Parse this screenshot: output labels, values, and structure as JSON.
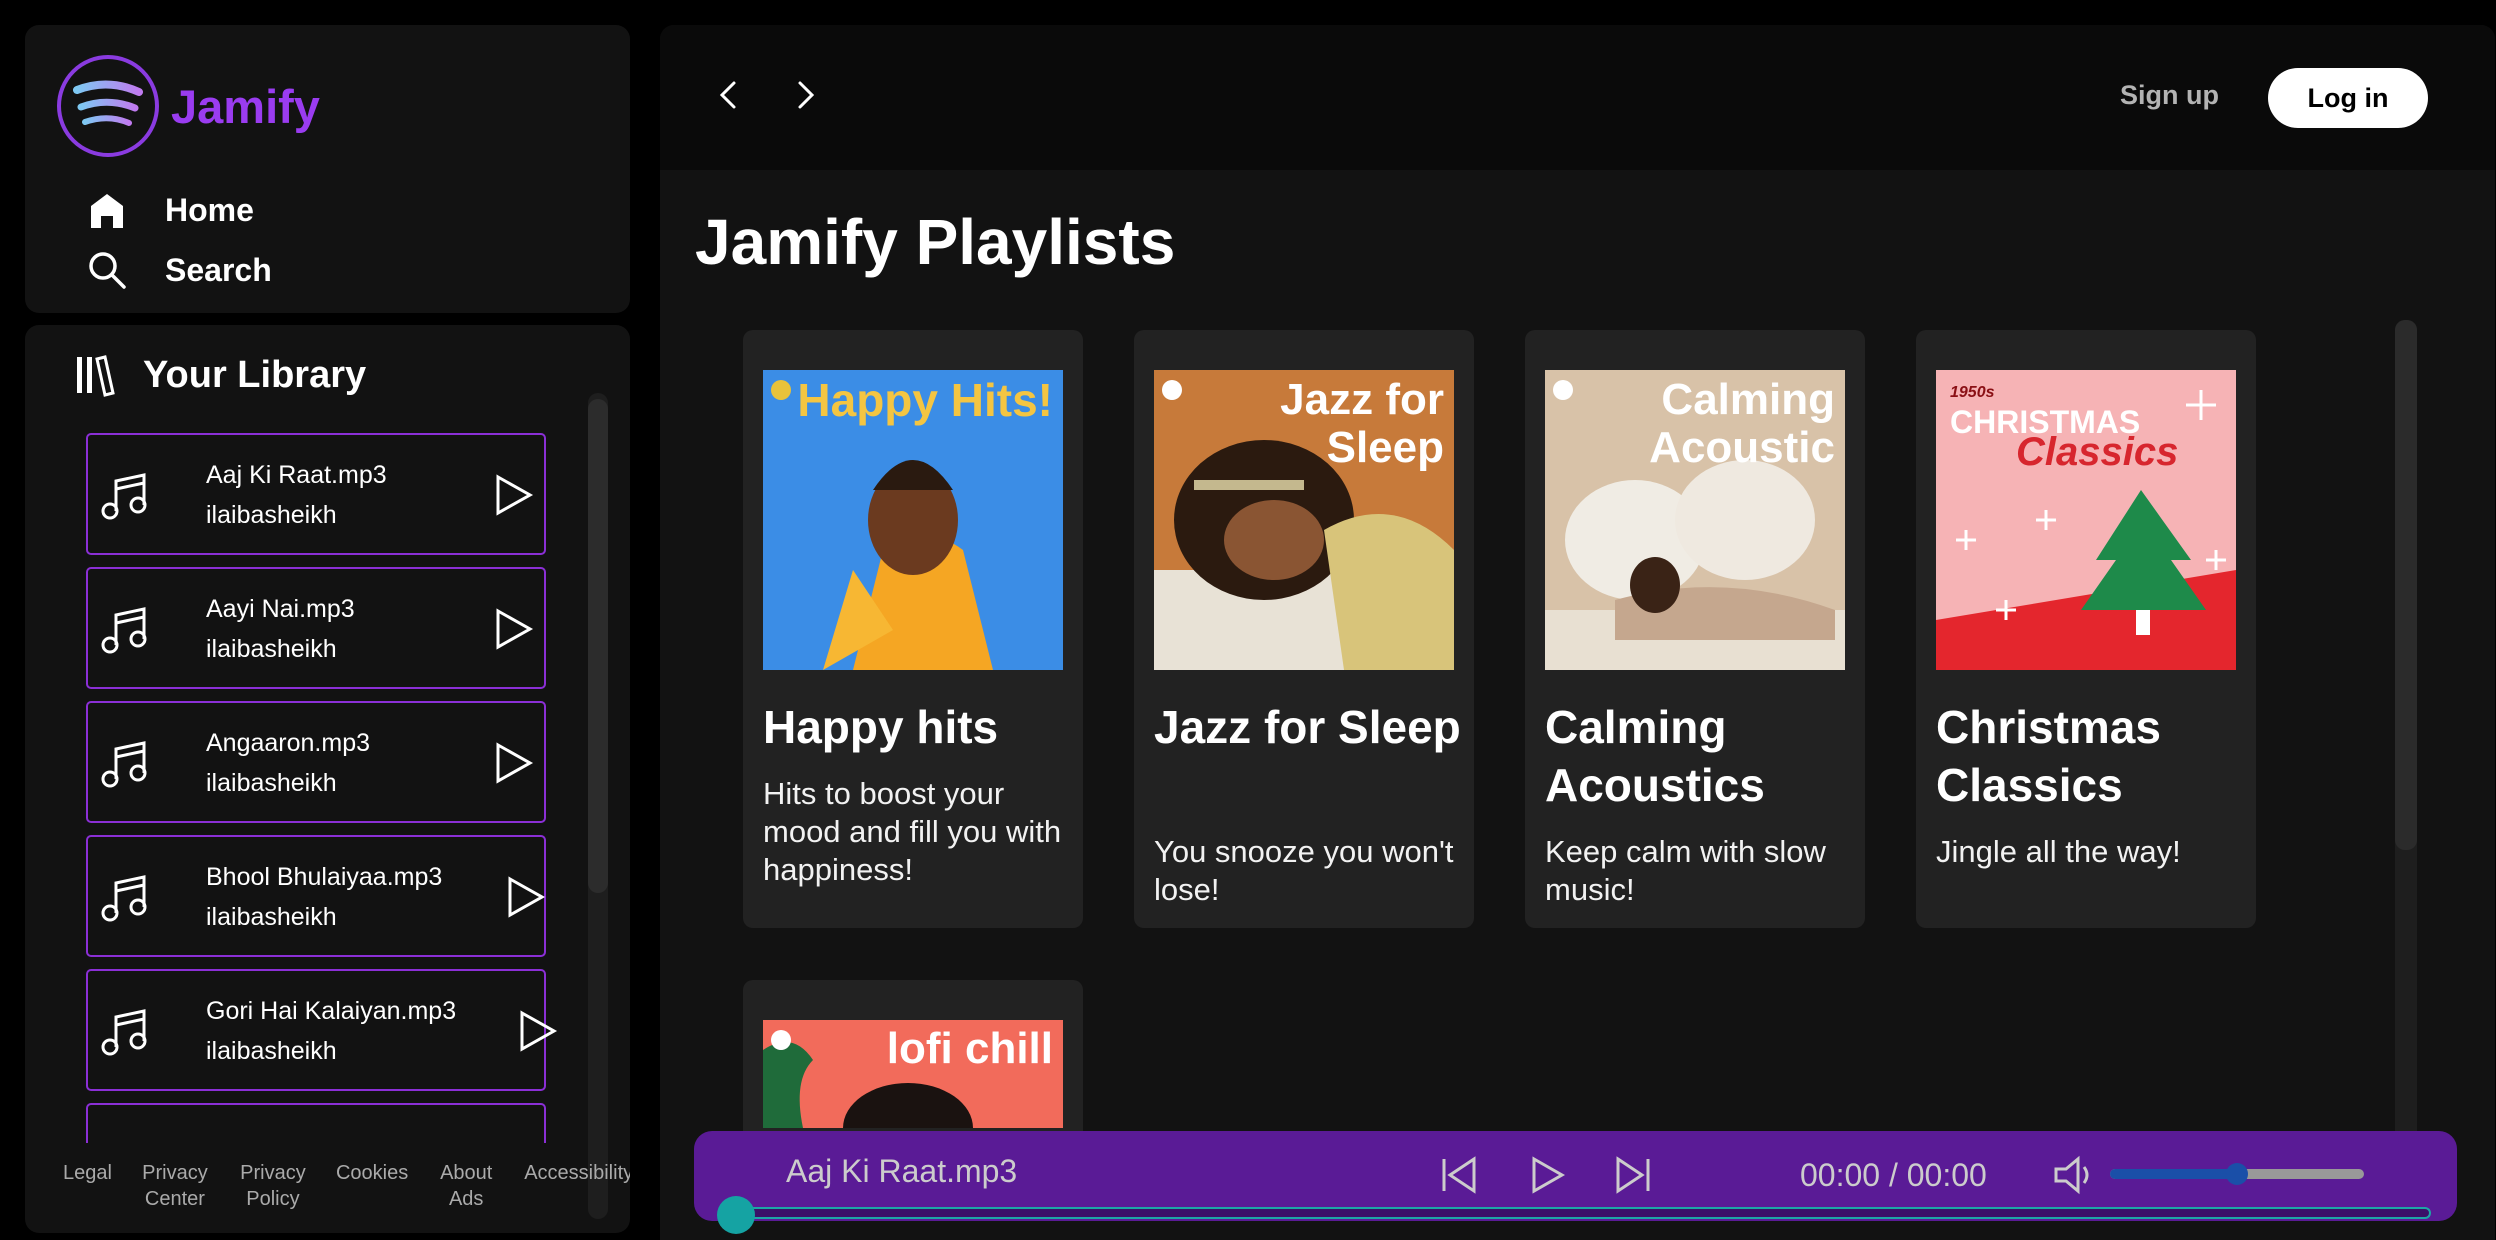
{
  "brand": {
    "name": "Jamify"
  },
  "nav": [
    {
      "label": "Home",
      "icon": "home-icon"
    },
    {
      "label": "Search",
      "icon": "search-icon"
    }
  ],
  "library": {
    "title": "Your Library",
    "songs": [
      {
        "title": "Aaj Ki Raat.mp3",
        "artist": "ilaibasheikh"
      },
      {
        "title": "Aayi Nai.mp3",
        "artist": "ilaibasheikh"
      },
      {
        "title": "Angaaron.mp3",
        "artist": "ilaibasheikh"
      },
      {
        "title": "Bhool Bhulaiyaa.mp3",
        "artist": "ilaibasheikh"
      },
      {
        "title": "Gori Hai Kalaiyan.mp3",
        "artist": "ilaibasheikh"
      }
    ]
  },
  "footer": {
    "links": [
      "Legal",
      "Privacy Center",
      "Privacy Policy",
      "Cookies",
      "About Ads",
      "Accessibility"
    ]
  },
  "header": {
    "signup": "Sign up",
    "login": "Log in"
  },
  "main": {
    "title": "Jamify Playlists",
    "playlists": [
      {
        "title": "Happy hits",
        "desc": "Hits to boost your mood and fill you with happiness!",
        "cover_text": "Happy Hits!",
        "cover_bg": "#3b8de6",
        "cover_fg": "#f4c542"
      },
      {
        "title": "Jazz for Sleep",
        "desc": "You snooze you won't lose!",
        "cover_text": "Jazz for Sleep",
        "cover_bg": "#c77a3a",
        "cover_fg": "#ffffff"
      },
      {
        "title": "Calming Acoustics",
        "desc": "Keep calm with slow music!",
        "cover_text": "Calming Acoustic",
        "cover_bg": "#d8c2a8",
        "cover_fg": "#ffffff"
      },
      {
        "title": "Christmas Classics",
        "desc": "Jingle all the way!",
        "cover_text_small": "1950s",
        "cover_text_mid": "CHRISTMAS",
        "cover_text": "Classics",
        "cover_bg": "#f6b3b5",
        "cover_fg": "#d7262e"
      },
      {
        "title": "",
        "desc": "",
        "cover_text": "lofi chill",
        "cover_bg": "#f26b5b",
        "cover_fg": "#ffffff"
      }
    ]
  },
  "player": {
    "now_playing": "Aaj Ki Raat.mp3",
    "time": "00:00 / 00:00",
    "volume": 0.5,
    "progress": 0
  },
  "colors": {
    "accent": "#8b2fd6",
    "player_bg": "#5a1b96",
    "seek": "#15a3a3",
    "volume": "#1a4fa8"
  }
}
